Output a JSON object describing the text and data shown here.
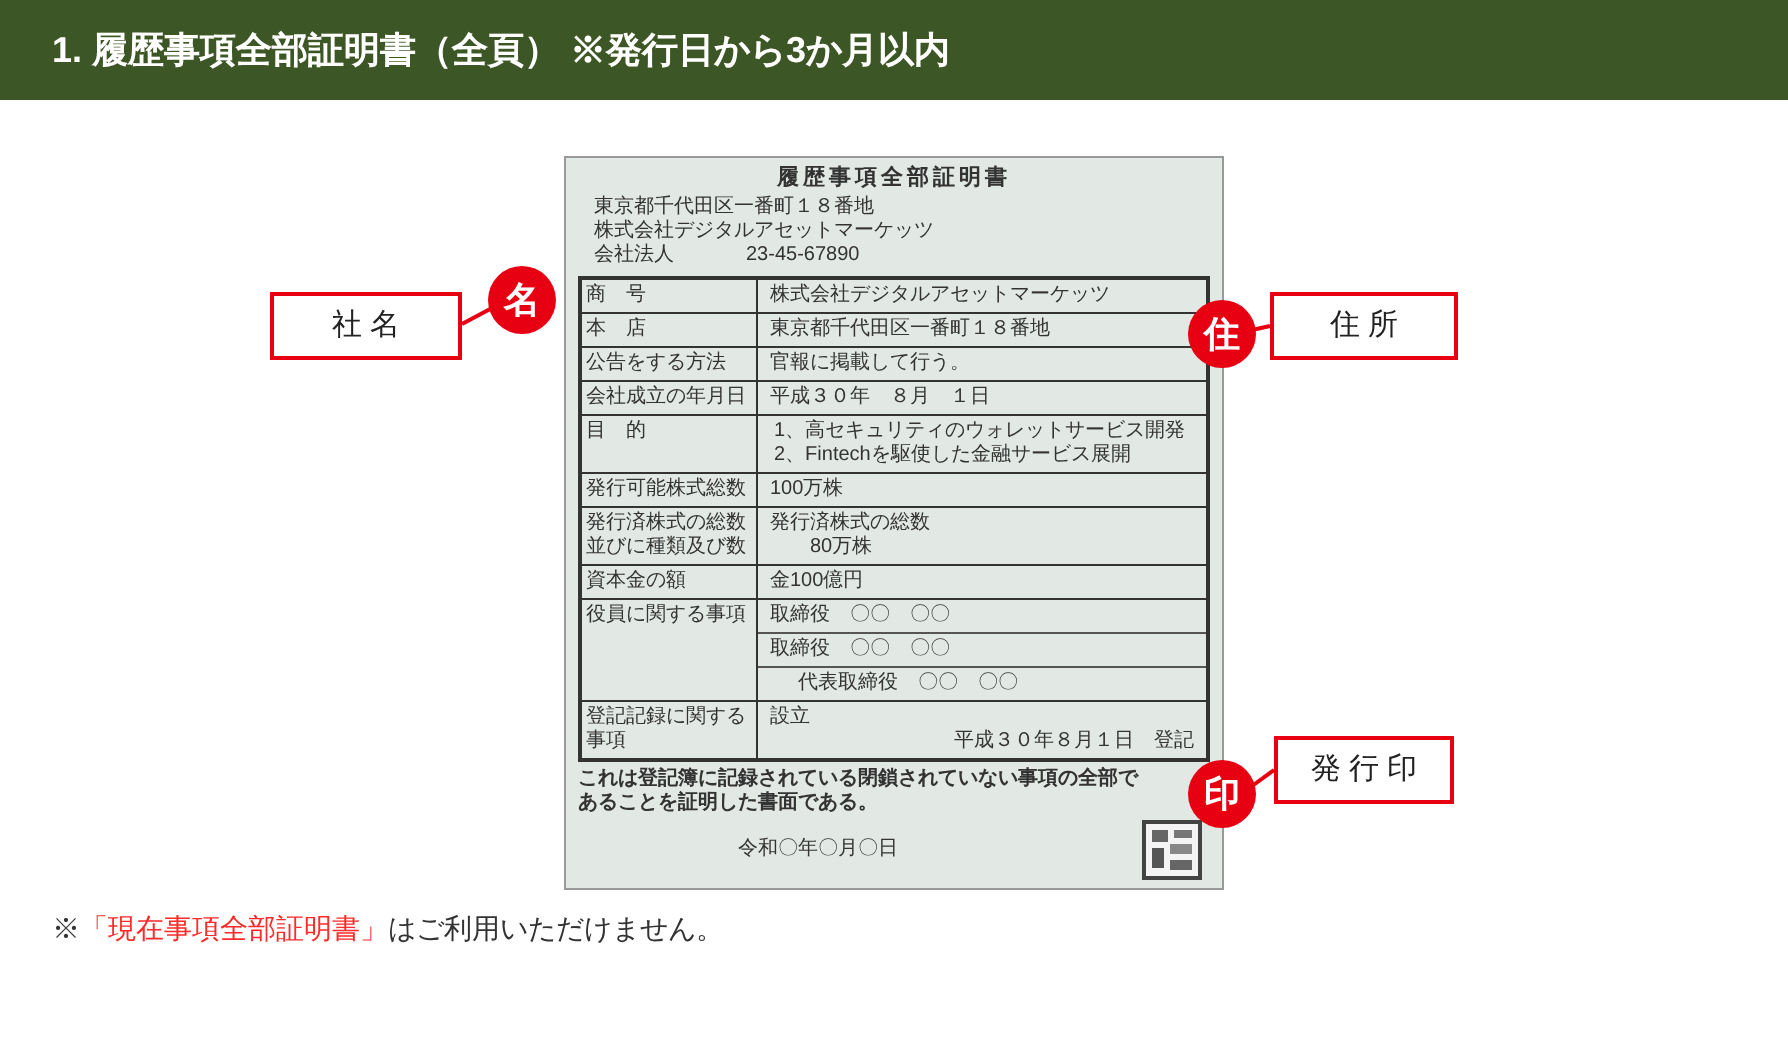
{
  "header": {
    "title": "1. 履歴事項全部証明書（全頁） ※発行日から3か月以内"
  },
  "document": {
    "title": "履歴事項全部証明書",
    "address_lines": [
      "東京都千代田区一番町１８番地",
      "株式会社デジタルアセットマーケッツ"
    ],
    "corporate_number": {
      "lead": "会社法人",
      "number": "23-45-67890"
    },
    "rows": [
      {
        "kind": "plain",
        "label": "商　号",
        "values": [
          "株式会社デジタルアセットマーケッツ"
        ]
      },
      {
        "kind": "plain",
        "label": "本　店",
        "values": [
          "東京都千代田区一番町１８番地"
        ]
      },
      {
        "kind": "plain",
        "label": "公告をする方法",
        "values": [
          "官報に掲載して行う。"
        ]
      },
      {
        "kind": "plain",
        "label": "会社成立の年月日",
        "values": [
          "平成３０年　８月　１日"
        ]
      },
      {
        "kind": "plain",
        "label": "目　的",
        "values": [
          "1、高セキュリティのウォレットサービス開発",
          "2、Fintechを駆使した金融サービス展開"
        ]
      },
      {
        "kind": "plain",
        "label": "発行可能株式総数",
        "values": [
          "100万株"
        ]
      },
      {
        "kind": "indented",
        "label": "発行済株式の総数並びに種類及び数",
        "values": [
          "発行済株式の総数",
          "80万株"
        ]
      },
      {
        "kind": "plain",
        "label": "資本金の額",
        "values": [
          "金100億円"
        ]
      },
      {
        "kind": "divided",
        "label": "役員に関する事項",
        "values": [
          "取締役　〇〇　〇〇",
          "取締役　〇〇　〇〇",
          "代表取締役　〇〇　〇〇"
        ]
      },
      {
        "kind": "registry",
        "label": "登記記録に関する事項",
        "values": [
          "設立",
          "平成３０年８月１日　登記"
        ]
      }
    ],
    "certification": "これは登記簿に記録されている閉鎖されていない事項の全部であることを証明した書面である。",
    "date": "令和〇年〇月〇日"
  },
  "callouts": [
    {
      "label": "社 名",
      "mark": "名"
    },
    {
      "label": "住 所",
      "mark": "住"
    },
    {
      "label": "発 行 印",
      "mark": "印"
    }
  ],
  "note": {
    "prefix": "※",
    "highlight": "「現在事項全部証明書」",
    "suffix": "はご利用いただけません。"
  }
}
